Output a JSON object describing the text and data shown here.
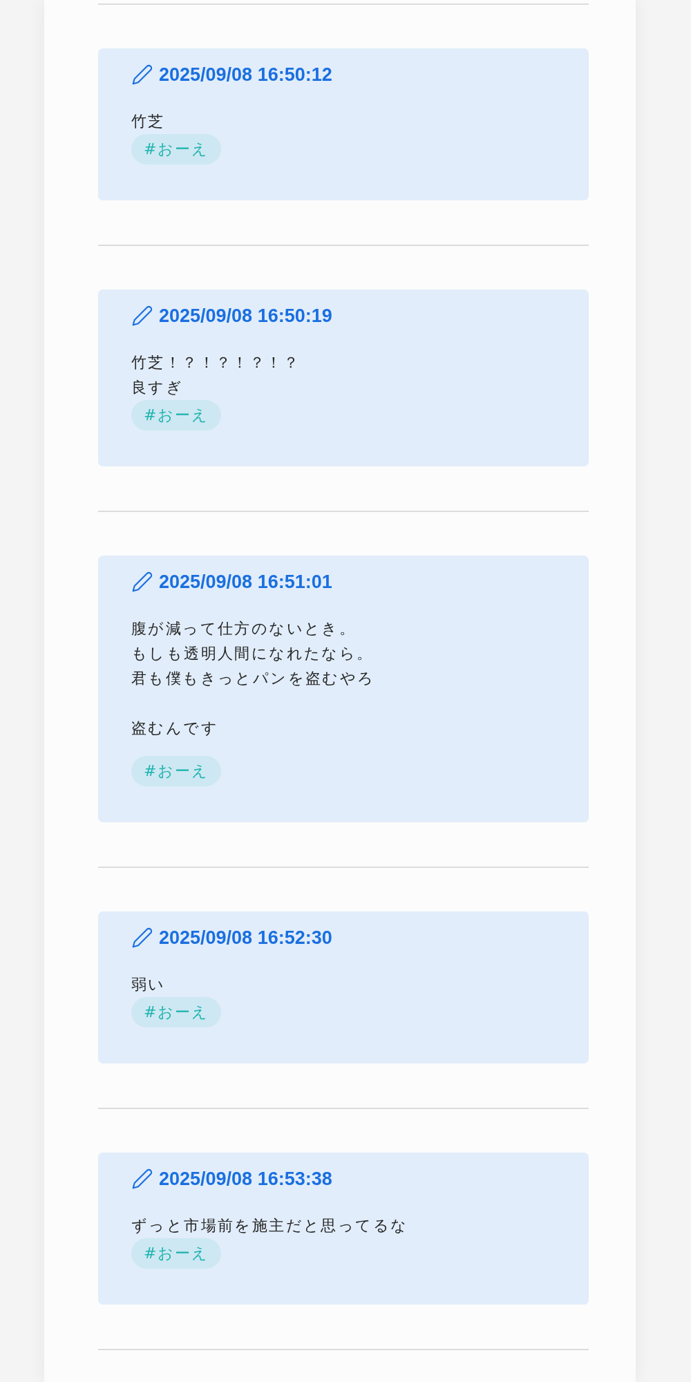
{
  "posts": [
    {
      "timestamp": "2025/09/08 16:50:12",
      "paragraphs": [
        [
          "竹芝"
        ]
      ],
      "tags": [
        "#おーえ"
      ]
    },
    {
      "timestamp": "2025/09/08 16:50:19",
      "paragraphs": [
        [
          "竹芝！？！？！？！？",
          "良すぎ"
        ]
      ],
      "tags": [
        "#おーえ"
      ]
    },
    {
      "timestamp": "2025/09/08 16:51:01",
      "paragraphs": [
        [
          "腹が減って仕方のないとき。",
          "もしも透明人間になれたなら。",
          "君も僕もきっとパンを盗むやろ"
        ],
        [
          "盗むんです"
        ]
      ],
      "tags": [
        "#おーえ"
      ]
    },
    {
      "timestamp": "2025/09/08 16:52:30",
      "paragraphs": [
        [
          "弱い"
        ]
      ],
      "tags": [
        "#おーえ"
      ]
    },
    {
      "timestamp": "2025/09/08 16:53:38",
      "paragraphs": [
        [
          "ずっと市場前を施主だと思ってるな"
        ]
      ],
      "tags": [
        "#おーえ"
      ]
    }
  ]
}
